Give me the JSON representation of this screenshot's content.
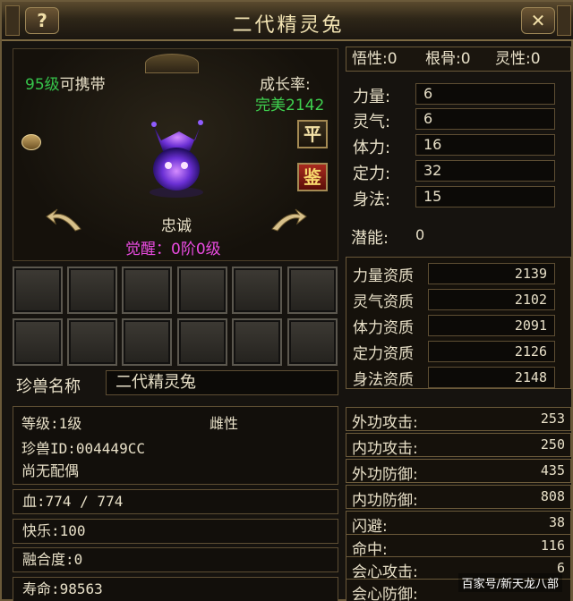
{
  "window": {
    "title": "二代精灵兔",
    "help": "?",
    "close": "✕"
  },
  "pet": {
    "level": "95级",
    "carry": "可携带",
    "growth_label": "成长率:",
    "growth_value": "完美2142",
    "loyalty": "忠诚",
    "awaken": "觉醒：0阶0级",
    "badge_ping": "平",
    "badge_jian": "鉴"
  },
  "name": {
    "label": "珍兽名称",
    "value": "二代精灵兔"
  },
  "info": {
    "level": "等级:1级",
    "gender": "雌性",
    "pet_id": "珍兽ID:004449CC",
    "spouse": "尚无配偶"
  },
  "status": {
    "hp": "血:774 / 774",
    "happy": "快乐:100",
    "fusion": "融合度:0",
    "life": "寿命:98563"
  },
  "top_stats": {
    "wuxing": "悟性:0",
    "gengu": "根骨:0",
    "lingxing": "灵性:0"
  },
  "attributes": [
    {
      "label": "力量:",
      "value": "6"
    },
    {
      "label": "灵气:",
      "value": "6"
    },
    {
      "label": "体力:",
      "value": "16"
    },
    {
      "label": "定力:",
      "value": "32"
    },
    {
      "label": "身法:",
      "value": "15"
    }
  ],
  "potential": {
    "label": "潜能:",
    "value": "0"
  },
  "aptitudes": [
    {
      "label": "力量资质",
      "value": "2139"
    },
    {
      "label": "灵气资质",
      "value": "2102"
    },
    {
      "label": "体力资质",
      "value": "2091"
    },
    {
      "label": "定力资质",
      "value": "2126"
    },
    {
      "label": "身法资质",
      "value": "2148"
    }
  ],
  "combat": [
    {
      "label": "外功攻击:",
      "value": "253"
    },
    {
      "label": "内功攻击:",
      "value": "250"
    },
    {
      "label": "外功防御:",
      "value": "435"
    },
    {
      "label": "内功防御:",
      "value": "808"
    },
    {
      "label": "闪避:",
      "value": "38"
    },
    {
      "label": "命中:",
      "value": "116"
    },
    {
      "label": "会心攻击:",
      "value": "6"
    },
    {
      "label": "会心防御:",
      "value": ""
    }
  ],
  "watermark": "百家号/新天龙八部",
  "colors": {
    "green": "#36c44b",
    "magenta": "#e94be0",
    "gold": "#f3e4b3",
    "border": "#6b5a3a"
  }
}
